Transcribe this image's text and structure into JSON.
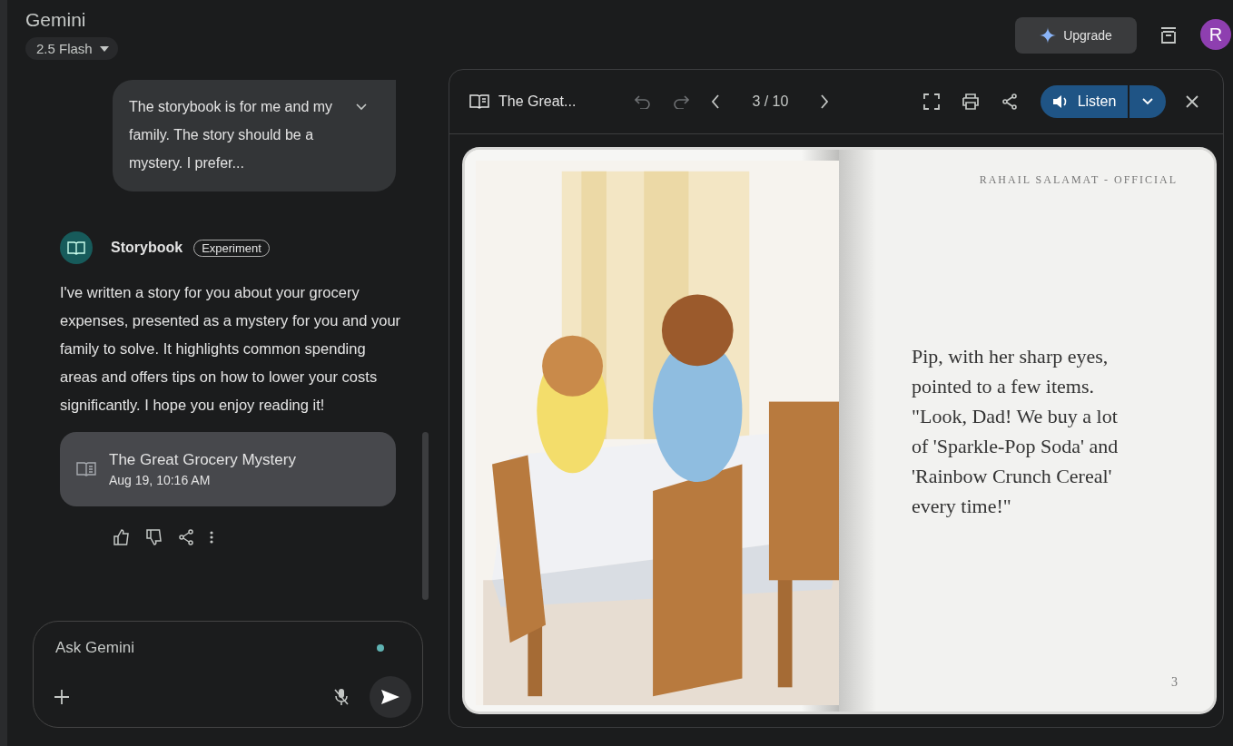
{
  "app": {
    "title": "Gemini",
    "model": "2.5 Flash"
  },
  "header": {
    "upgrade": "Upgrade",
    "avatar": "R"
  },
  "chat": {
    "user_message": {
      "text": "The storybook is for me and my family. The story should be a mystery. I prefer...",
      "expanded": false
    },
    "response": {
      "author": "Storybook",
      "badge": "Experiment",
      "text": "I've written a story for you about your grocery expenses, presented as a mystery for you and your family to solve. It highlights common spending areas and offers tips on how to lower your costs significantly. I hope you enjoy reading it!"
    },
    "attachment": {
      "title": "The Great Grocery Mystery",
      "date": "Aug 19, 10:16 AM"
    }
  },
  "input": {
    "placeholder": "Ask Gemini"
  },
  "viewer": {
    "title": "The Great...",
    "undo_disabled": true,
    "redo_disabled": true,
    "page": "3 / 10",
    "listen": "Listen",
    "right_page": {
      "header": "RAHAIL SALAMAT - OFFICIAL",
      "lines": [
        "Pip, with her sharp eyes,",
        "pointed to a few items.",
        "\"Look, Dad! We buy a lot",
        "of 'Sparkle-Pop Soda' and",
        "'Rainbow Crunch Cereal'",
        "every time!\""
      ],
      "page_number": "3"
    }
  }
}
